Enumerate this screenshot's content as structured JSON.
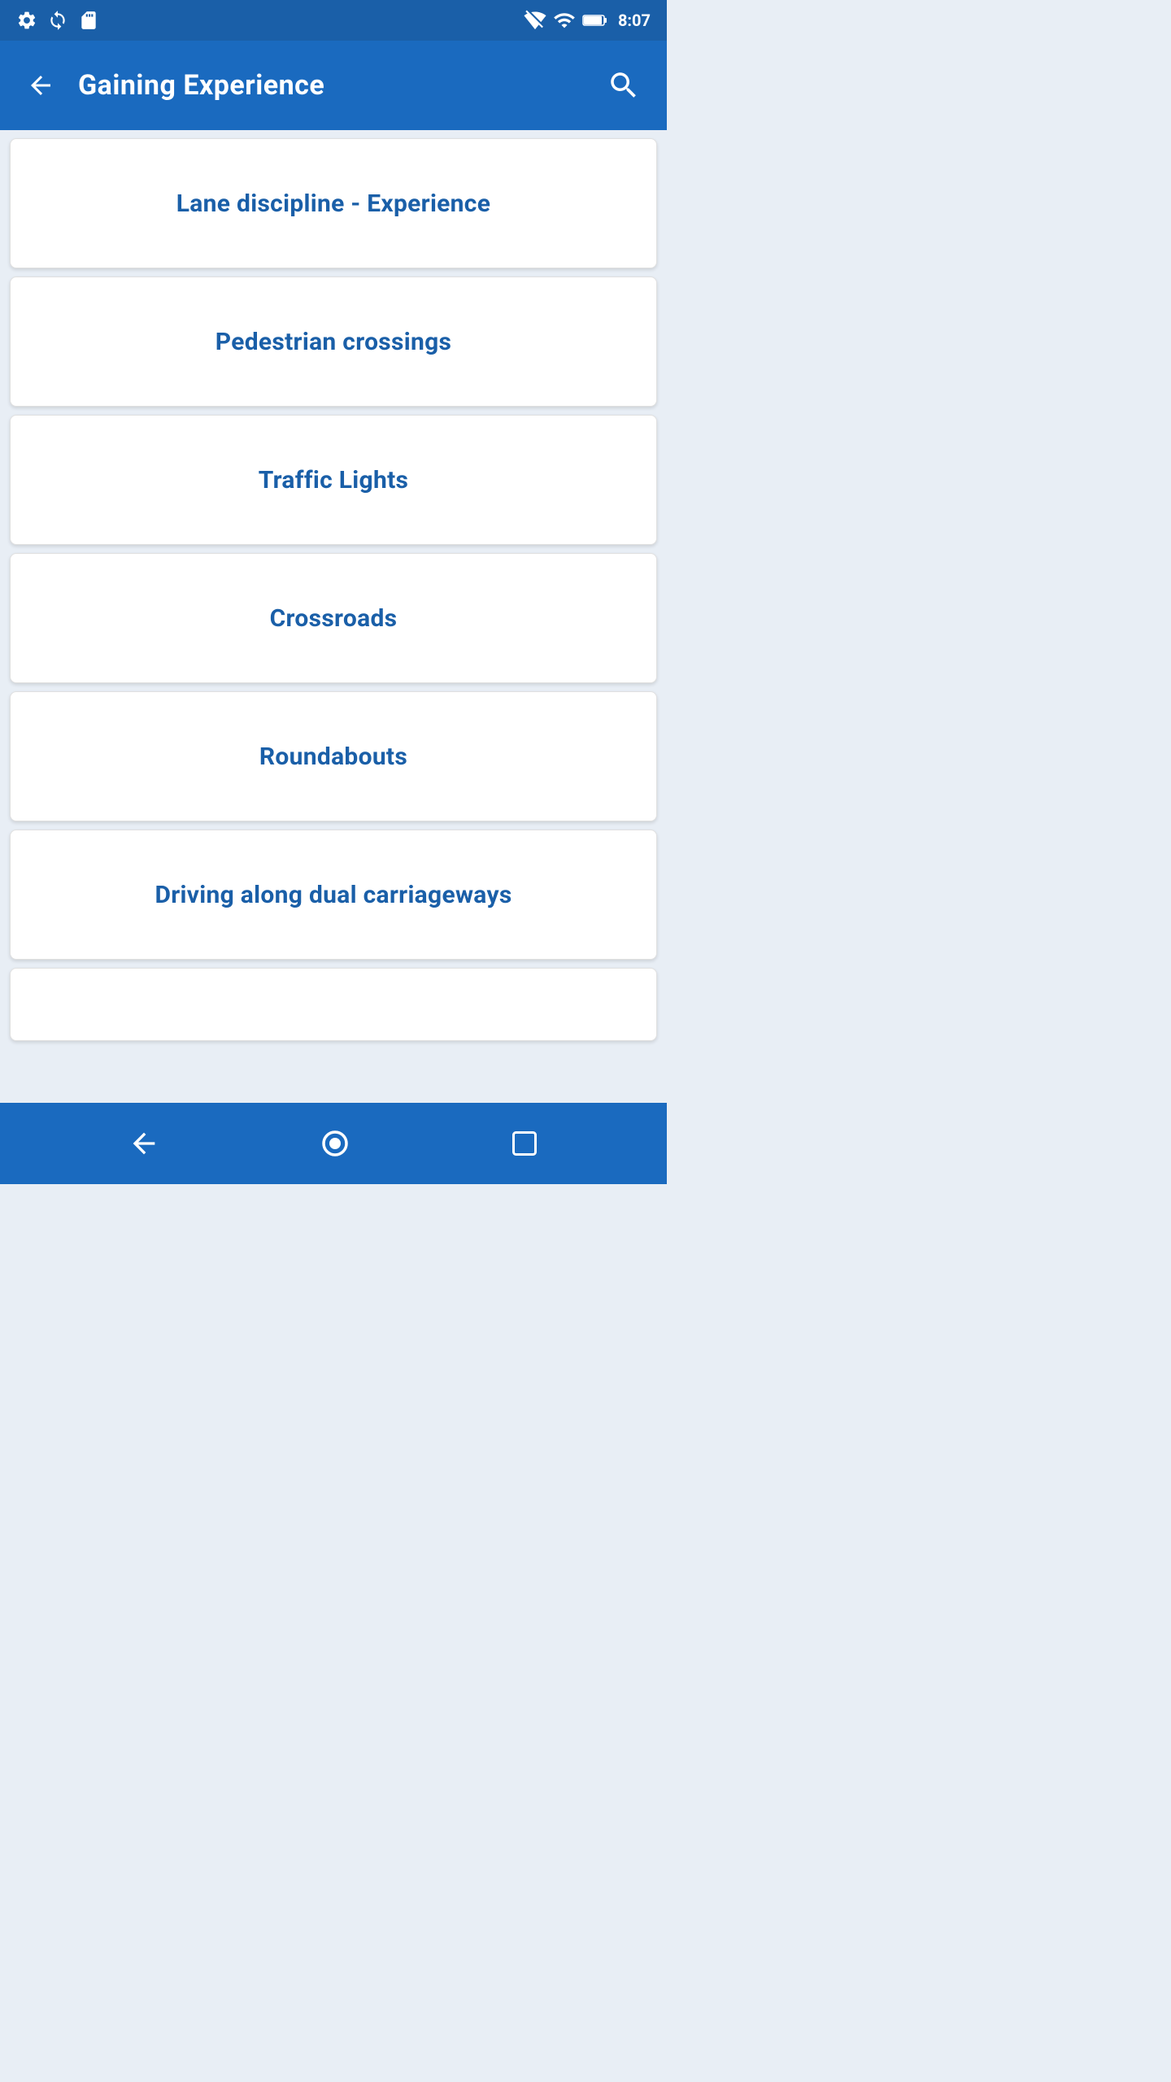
{
  "statusBar": {
    "time": "8:07",
    "icons": {
      "gear": "gear-icon",
      "sync": "sync-icon",
      "sdcard": "sdcard-icon",
      "wifi": "wifi-icon",
      "signal": "signal-icon",
      "battery": "battery-icon"
    }
  },
  "appBar": {
    "title": "Gaining Experience",
    "backLabel": "back",
    "searchLabel": "search"
  },
  "menuItems": [
    {
      "id": 1,
      "label": "Lane discipline - Experience"
    },
    {
      "id": 2,
      "label": "Pedestrian crossings"
    },
    {
      "id": 3,
      "label": "Traffic Lights"
    },
    {
      "id": 4,
      "label": "Crossroads"
    },
    {
      "id": 5,
      "label": "Roundabouts"
    },
    {
      "id": 6,
      "label": "Driving along dual carriageways"
    }
  ],
  "bottomNav": {
    "back": "back-nav",
    "home": "home-nav",
    "recent": "recent-nav"
  },
  "colors": {
    "primary": "#1a6abf",
    "primaryDark": "#1a5fa8",
    "background": "#e8eef5",
    "cardBackground": "#ffffff",
    "textPrimary": "#1a5fa8"
  }
}
